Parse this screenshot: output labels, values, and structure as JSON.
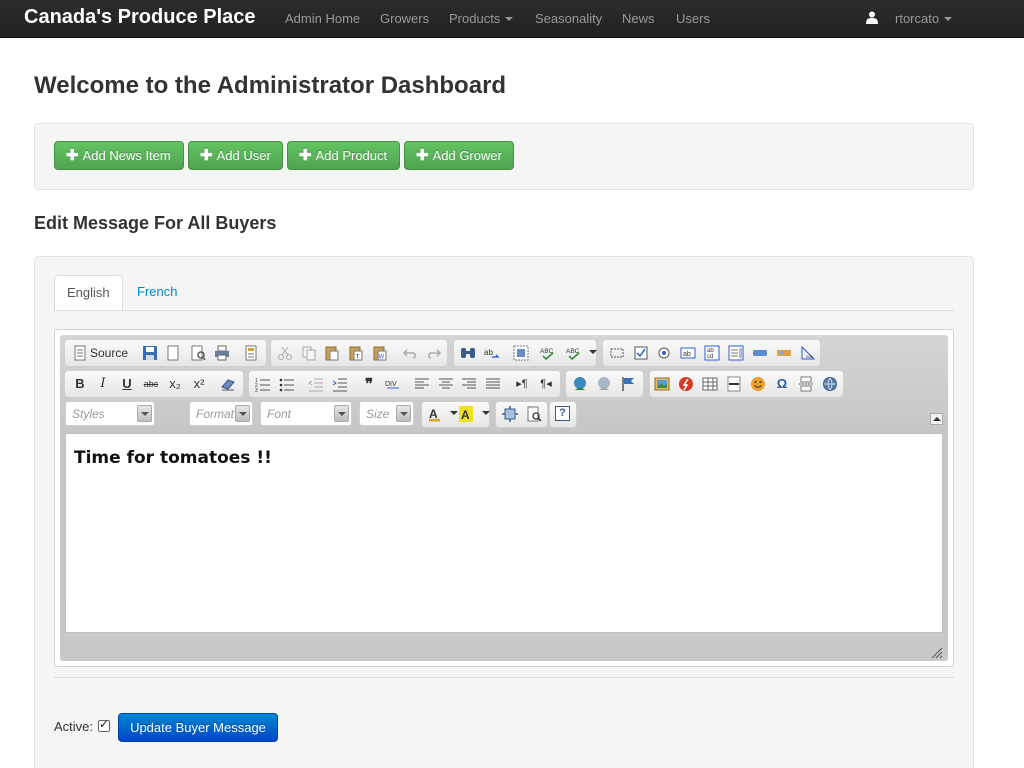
{
  "navbar": {
    "brand": "Canada's Produce Place",
    "items": [
      {
        "label": "Admin Home"
      },
      {
        "label": "Growers"
      },
      {
        "label": "Products"
      },
      {
        "label": "Seasonality"
      },
      {
        "label": "News"
      },
      {
        "label": "Users"
      }
    ],
    "user": "rtorcato"
  },
  "page": {
    "title": "Welcome to the Administrator Dashboard",
    "actions": [
      {
        "label": "Add News Item"
      },
      {
        "label": "Add User"
      },
      {
        "label": "Add Product"
      },
      {
        "label": "Add Grower"
      }
    ],
    "section_heading": "Edit Message For All Buyers"
  },
  "tabs": [
    {
      "label": "English",
      "active": true
    },
    {
      "label": "French",
      "active": false
    }
  ],
  "editor": {
    "source_label": "Source",
    "combos": {
      "styles": "Styles",
      "format": "Format",
      "font": "Font",
      "size": "Size"
    },
    "toolbar_text": {
      "bold": "B",
      "italic": "I",
      "underline": "U",
      "strike": "abc",
      "subscript": "x₂",
      "superscript": "x²",
      "help": "?"
    },
    "content": "Time for tomatoes !!"
  },
  "form": {
    "active_label": "Active:",
    "active_checked": true,
    "submit_label": "Update Buyer Message"
  },
  "colors": {
    "navbar_bg": "#222222",
    "success": "#5bb75b",
    "primary": "#006dcc",
    "link": "#0088cc"
  }
}
